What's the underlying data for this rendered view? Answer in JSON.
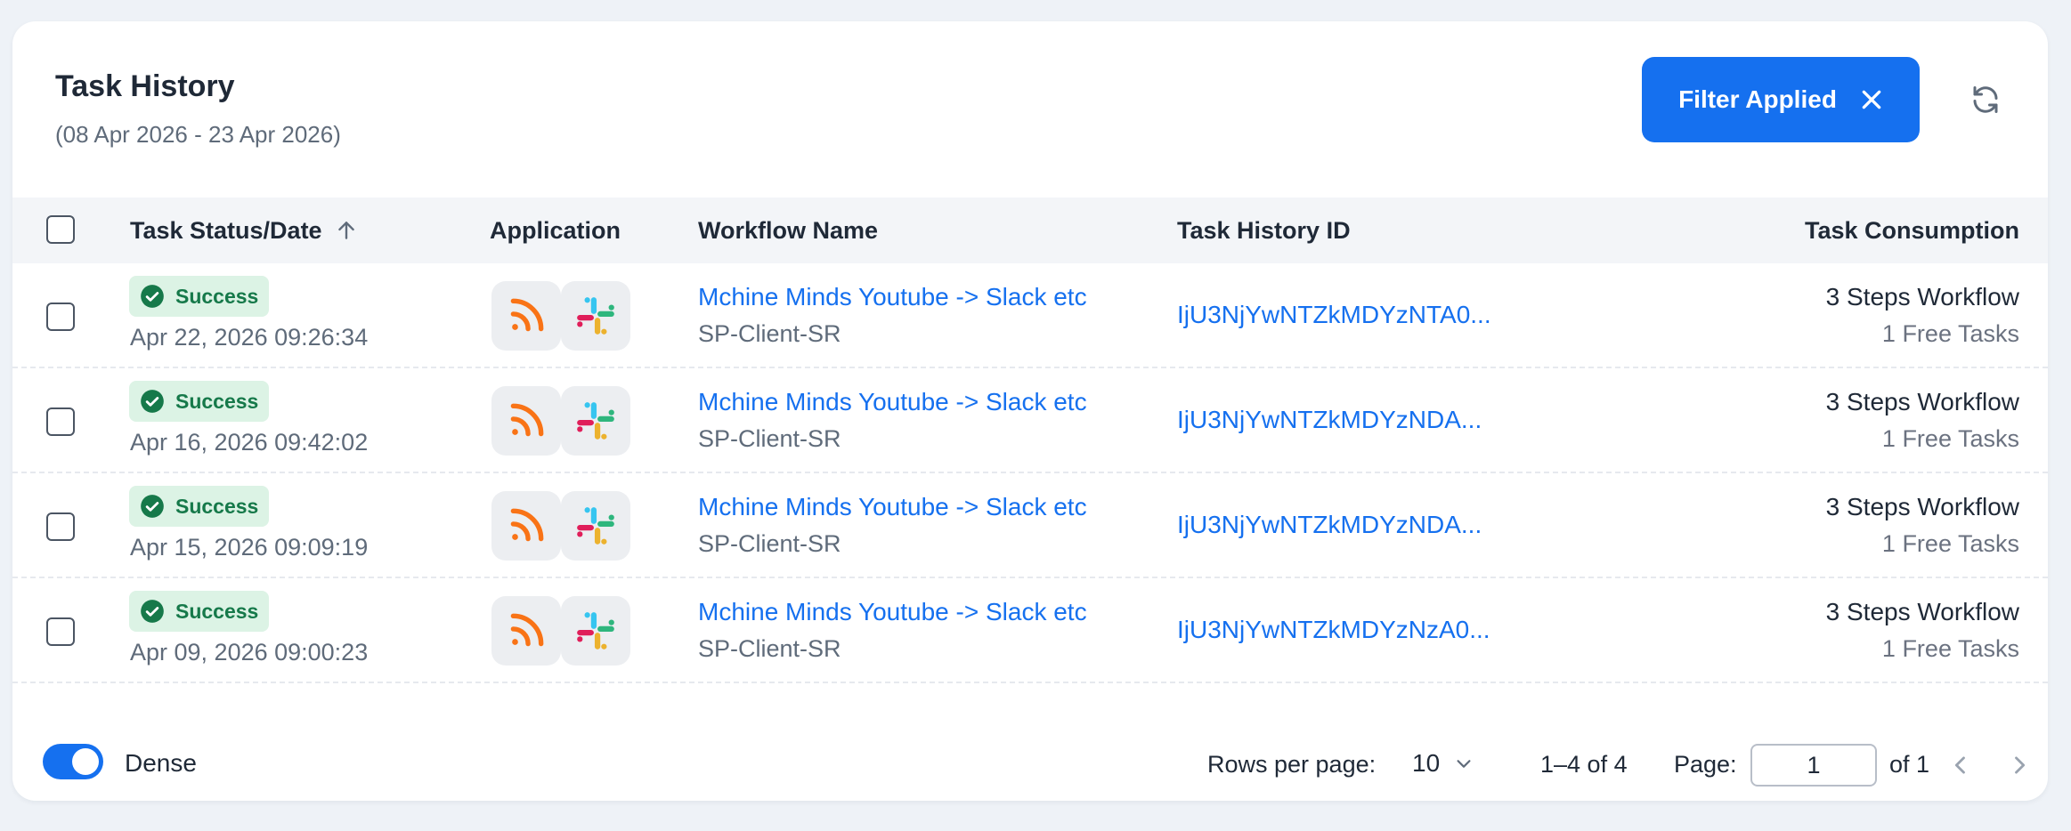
{
  "header": {
    "title": "Task History",
    "date_range": "(08 Apr 2026 - 23 Apr 2026)",
    "filter_button_label": "Filter Applied"
  },
  "table": {
    "columns": {
      "status_date": "Task Status/Date",
      "application": "Application",
      "workflow_name": "Workflow Name",
      "task_history_id": "Task History ID",
      "task_consumption": "Task Consumption"
    },
    "rows": [
      {
        "status": "Success",
        "date": "Apr 22, 2026 09:26:34",
        "apps": [
          "rss-icon",
          "slack-icon"
        ],
        "workflow_name": "Mchine Minds Youtube -> Slack etc",
        "client": "SP-Client-SR",
        "history_id": "IjU3NjYwNTZkMDYzNTA0...",
        "steps": "3 Steps Workflow",
        "tasks": "1 Free Tasks"
      },
      {
        "status": "Success",
        "date": "Apr 16, 2026 09:42:02",
        "apps": [
          "rss-icon",
          "slack-icon"
        ],
        "workflow_name": "Mchine Minds Youtube -> Slack etc",
        "client": "SP-Client-SR",
        "history_id": "IjU3NjYwNTZkMDYzNDA...",
        "steps": "3 Steps Workflow",
        "tasks": "1 Free Tasks"
      },
      {
        "status": "Success",
        "date": "Apr 15, 2026 09:09:19",
        "apps": [
          "rss-icon",
          "slack-icon"
        ],
        "workflow_name": "Mchine Minds Youtube -> Slack etc",
        "client": "SP-Client-SR",
        "history_id": "IjU3NjYwNTZkMDYzNDA...",
        "steps": "3 Steps Workflow",
        "tasks": "1 Free Tasks"
      },
      {
        "status": "Success",
        "date": "Apr 09, 2026 09:00:23",
        "apps": [
          "rss-icon",
          "slack-icon"
        ],
        "workflow_name": "Mchine Minds Youtube -> Slack etc",
        "client": "SP-Client-SR",
        "history_id": "IjU3NjYwNTZkMDYzNzA0...",
        "steps": "3 Steps Workflow",
        "tasks": "1 Free Tasks"
      }
    ]
  },
  "footer": {
    "dense_label": "Dense",
    "dense_enabled": true,
    "rows_per_page_label": "Rows per page:",
    "rows_per_page_value": "10",
    "range_text": "1–4 of 4",
    "page_label": "Page:",
    "page_value": "1",
    "page_of": "of 1"
  },
  "colors": {
    "accent": "#1570ef",
    "success_bg": "#dcf3e5",
    "success_text": "#16794a",
    "rss_orange": "#f97316"
  }
}
